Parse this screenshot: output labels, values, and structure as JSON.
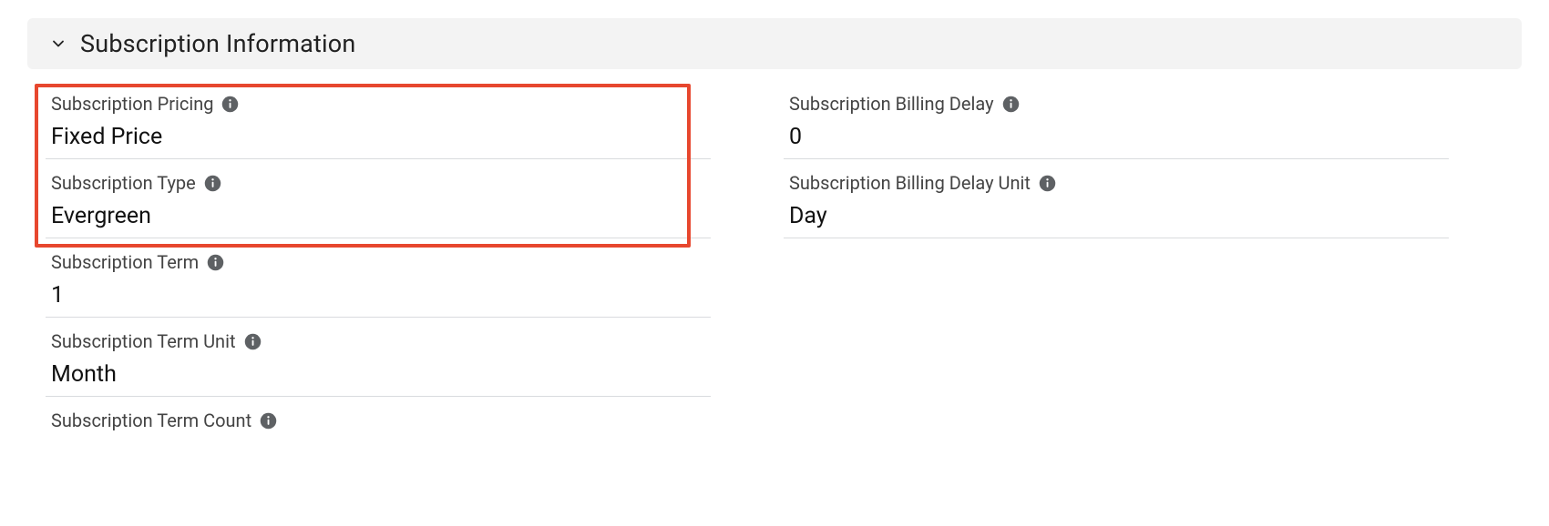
{
  "section": {
    "title": "Subscription Information"
  },
  "left": {
    "subscription_pricing": {
      "label": "Subscription Pricing",
      "value": "Fixed Price"
    },
    "subscription_type": {
      "label": "Subscription Type",
      "value": "Evergreen"
    },
    "subscription_term": {
      "label": "Subscription Term",
      "value": "1"
    },
    "subscription_term_unit": {
      "label": "Subscription Term Unit",
      "value": "Month"
    },
    "subscription_term_count": {
      "label": "Subscription Term Count",
      "value": ""
    }
  },
  "right": {
    "billing_delay": {
      "label": "Subscription Billing Delay",
      "value": "0"
    },
    "billing_delay_unit": {
      "label": "Subscription Billing Delay Unit",
      "value": "Day"
    }
  }
}
